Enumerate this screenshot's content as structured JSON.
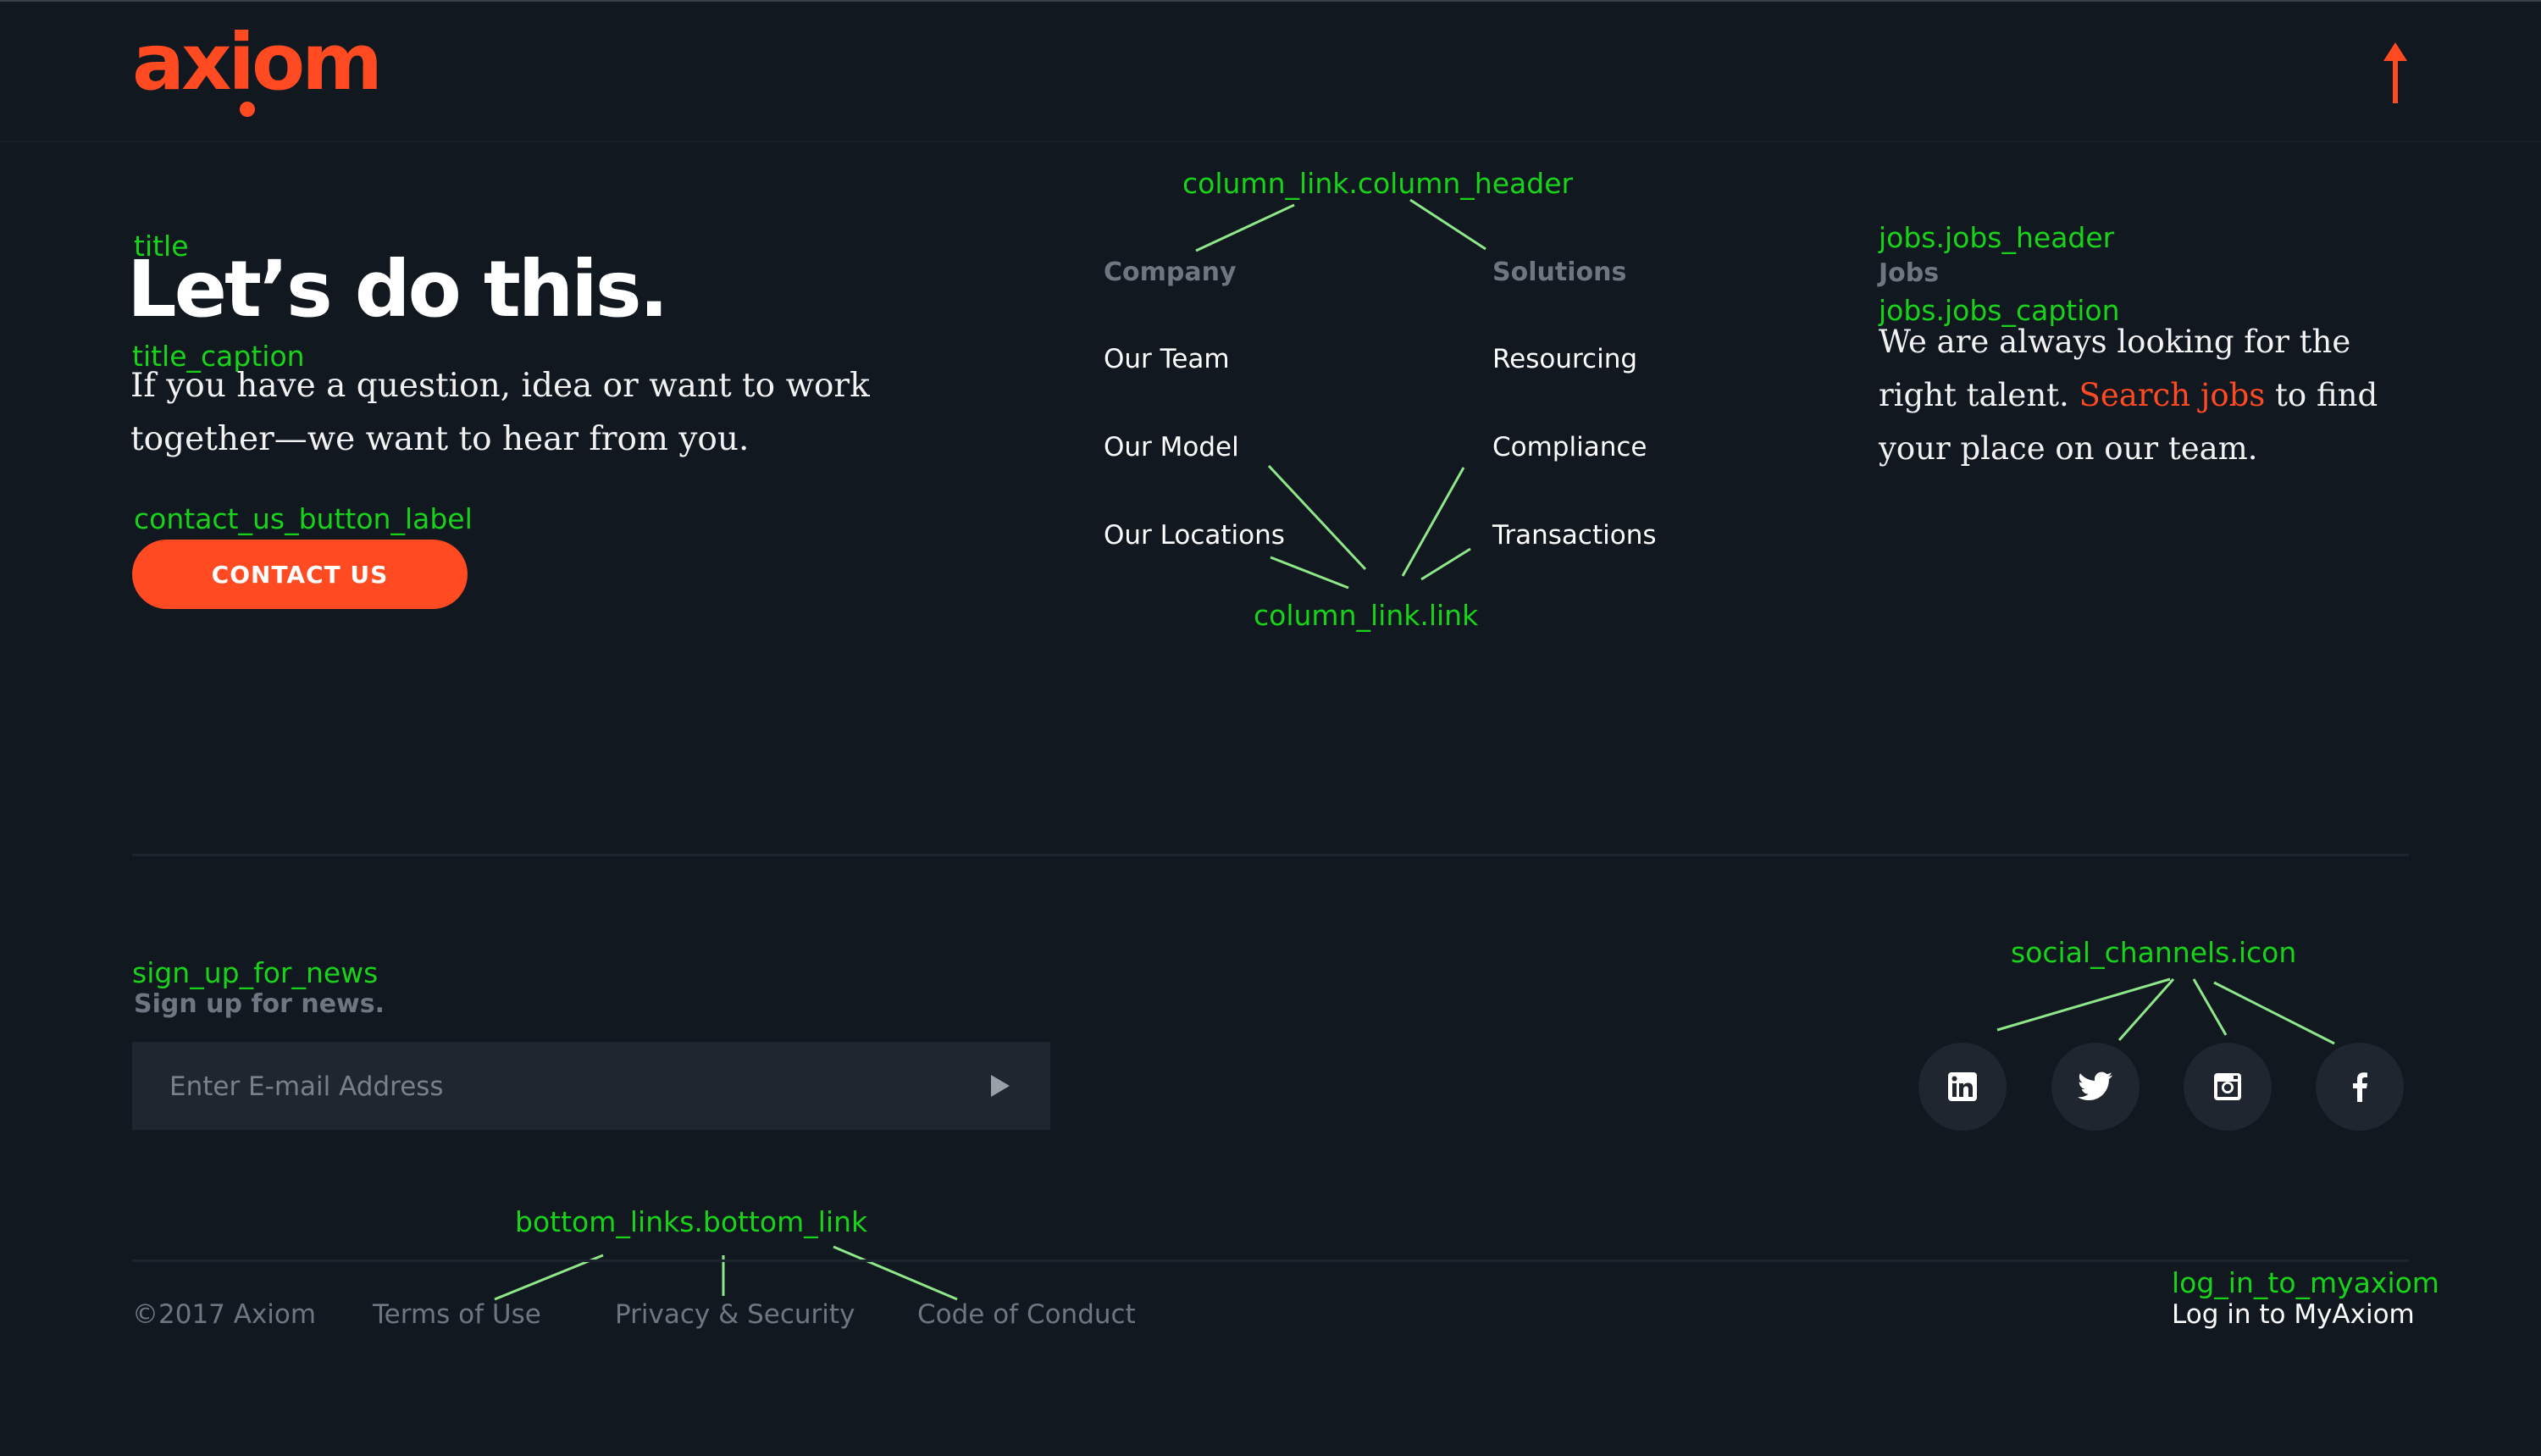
{
  "logo": {
    "text": "axiom"
  },
  "annotations": {
    "title": "title",
    "title_caption": "title_caption",
    "contact_us_button_label": "contact_us_button_label",
    "column_link_column_header": "column_link.column_header",
    "column_link_link": "column_link.link",
    "jobs_header": "jobs.jobs_header",
    "jobs_caption": "jobs.jobs_caption",
    "sign_up_for_news": "sign_up_for_news",
    "social_channels_icon": "social_channels.icon",
    "bottom_links_bottom_link": "bottom_links.bottom_link",
    "log_in_to_myaxiom": "log_in_to_myaxiom"
  },
  "hero": {
    "title": "Let’s do this.",
    "caption": "If you have a question, idea or want to work together—we want to hear from you.",
    "contact_us_button_label": "CONTACT US"
  },
  "columns": [
    {
      "header": "Company",
      "links": [
        "Our Team",
        "Our Model",
        "Our Locations"
      ]
    },
    {
      "header": "Solutions",
      "links": [
        "Resourcing",
        "Compliance",
        "Transactions"
      ]
    }
  ],
  "jobs": {
    "header": "Jobs",
    "caption_before": "We are always looking for the right talent. ",
    "link": "Search jobs",
    "caption_after": " to find your place on our team."
  },
  "news": {
    "label": "Sign up for news.",
    "placeholder": "Enter E-mail Address"
  },
  "social_channels": [
    {
      "icon": "linkedin-icon"
    },
    {
      "icon": "twitter-icon"
    },
    {
      "icon": "instagram-icon"
    },
    {
      "icon": "facebook-icon"
    }
  ],
  "footer": {
    "copyright": "©2017 Axiom",
    "bottom_links": [
      "Terms of Use",
      "Privacy & Security",
      "Code of Conduct"
    ],
    "login": "Log in to MyAxiom"
  },
  "colors": {
    "background": "#111820",
    "accent": "#ff4a22",
    "annotation": "#19d31b",
    "muted": "#6e7682",
    "field": "#1f262f"
  }
}
